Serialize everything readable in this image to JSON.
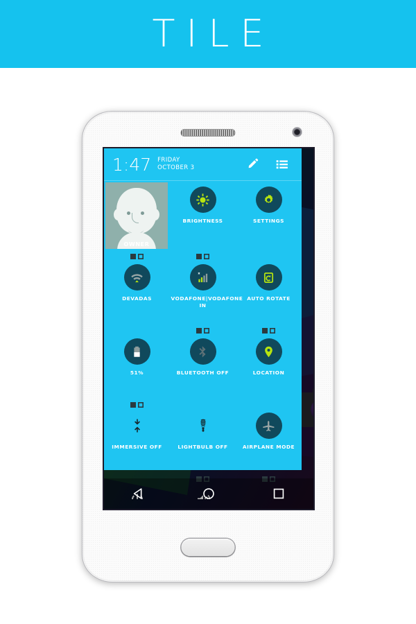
{
  "banner": {
    "title": "TILE"
  },
  "statusbar": {
    "time": "1:47",
    "day": "FRIDAY",
    "date": "OCTOBER 3",
    "edit_icon": "pencil-icon",
    "list_icon": "list-icon"
  },
  "user": {
    "name": "OWNER"
  },
  "tiles": [
    {
      "label": "BRIGHTNESS",
      "icon": "brightness-icon",
      "style": "circle",
      "glyph_color": "#b6e410"
    },
    {
      "label": "SETTINGS",
      "icon": "settings-gear-icon",
      "style": "circle",
      "glyph_color": "#b6e410"
    },
    {
      "label": "DEVADAS",
      "icon": "wifi-icon",
      "style": "circle",
      "glyph_color": "#9aa6a6"
    },
    {
      "label": "VODAFONE|VODAFONE IN",
      "icon": "signal-bars-icon",
      "style": "circle",
      "glyph_color": "#b6e410"
    },
    {
      "label": "AUTO ROTATE",
      "icon": "auto-rotate-icon",
      "style": "circle",
      "glyph_color": "#b6e410"
    },
    {
      "label": "51%",
      "icon": "battery-icon",
      "style": "circle",
      "glyph_color": "#ffffff"
    },
    {
      "label": "BLUETOOTH OFF",
      "icon": "bluetooth-icon",
      "style": "circle",
      "glyph_color": "#5f7277"
    },
    {
      "label": "LOCATION",
      "icon": "location-pin-icon",
      "style": "circle",
      "glyph_color": "#b6e410"
    },
    {
      "label": "IMMERSIVE OFF",
      "icon": "immersive-arrows-icon",
      "style": "plain",
      "glyph_color": "#1b2b30"
    },
    {
      "label": "LIGHTBULB OFF",
      "icon": "lightbulb-icon",
      "style": "plain",
      "glyph_color": "#1b2b30"
    },
    {
      "label": "AIRPLANE MODE",
      "icon": "airplane-icon",
      "style": "circle",
      "glyph_color": "#9aa6a6"
    },
    {
      "label": "",
      "icon": "power-icon",
      "style": "plain",
      "glyph_color": "#ffffff"
    },
    {
      "label": "",
      "icon": "volume-icon",
      "style": "plain",
      "glyph_color": "#ffffff"
    }
  ],
  "navbar": {
    "back": "back-triangle-icon",
    "home": "home-circle-icon",
    "recents": "recents-square-icon"
  },
  "colors": {
    "accent": "#1fc5f2",
    "banner": "#15c2ee",
    "tile_circle": "#10495c",
    "tile_glyph": "#b6e410",
    "page_bg": "#ffffff"
  }
}
